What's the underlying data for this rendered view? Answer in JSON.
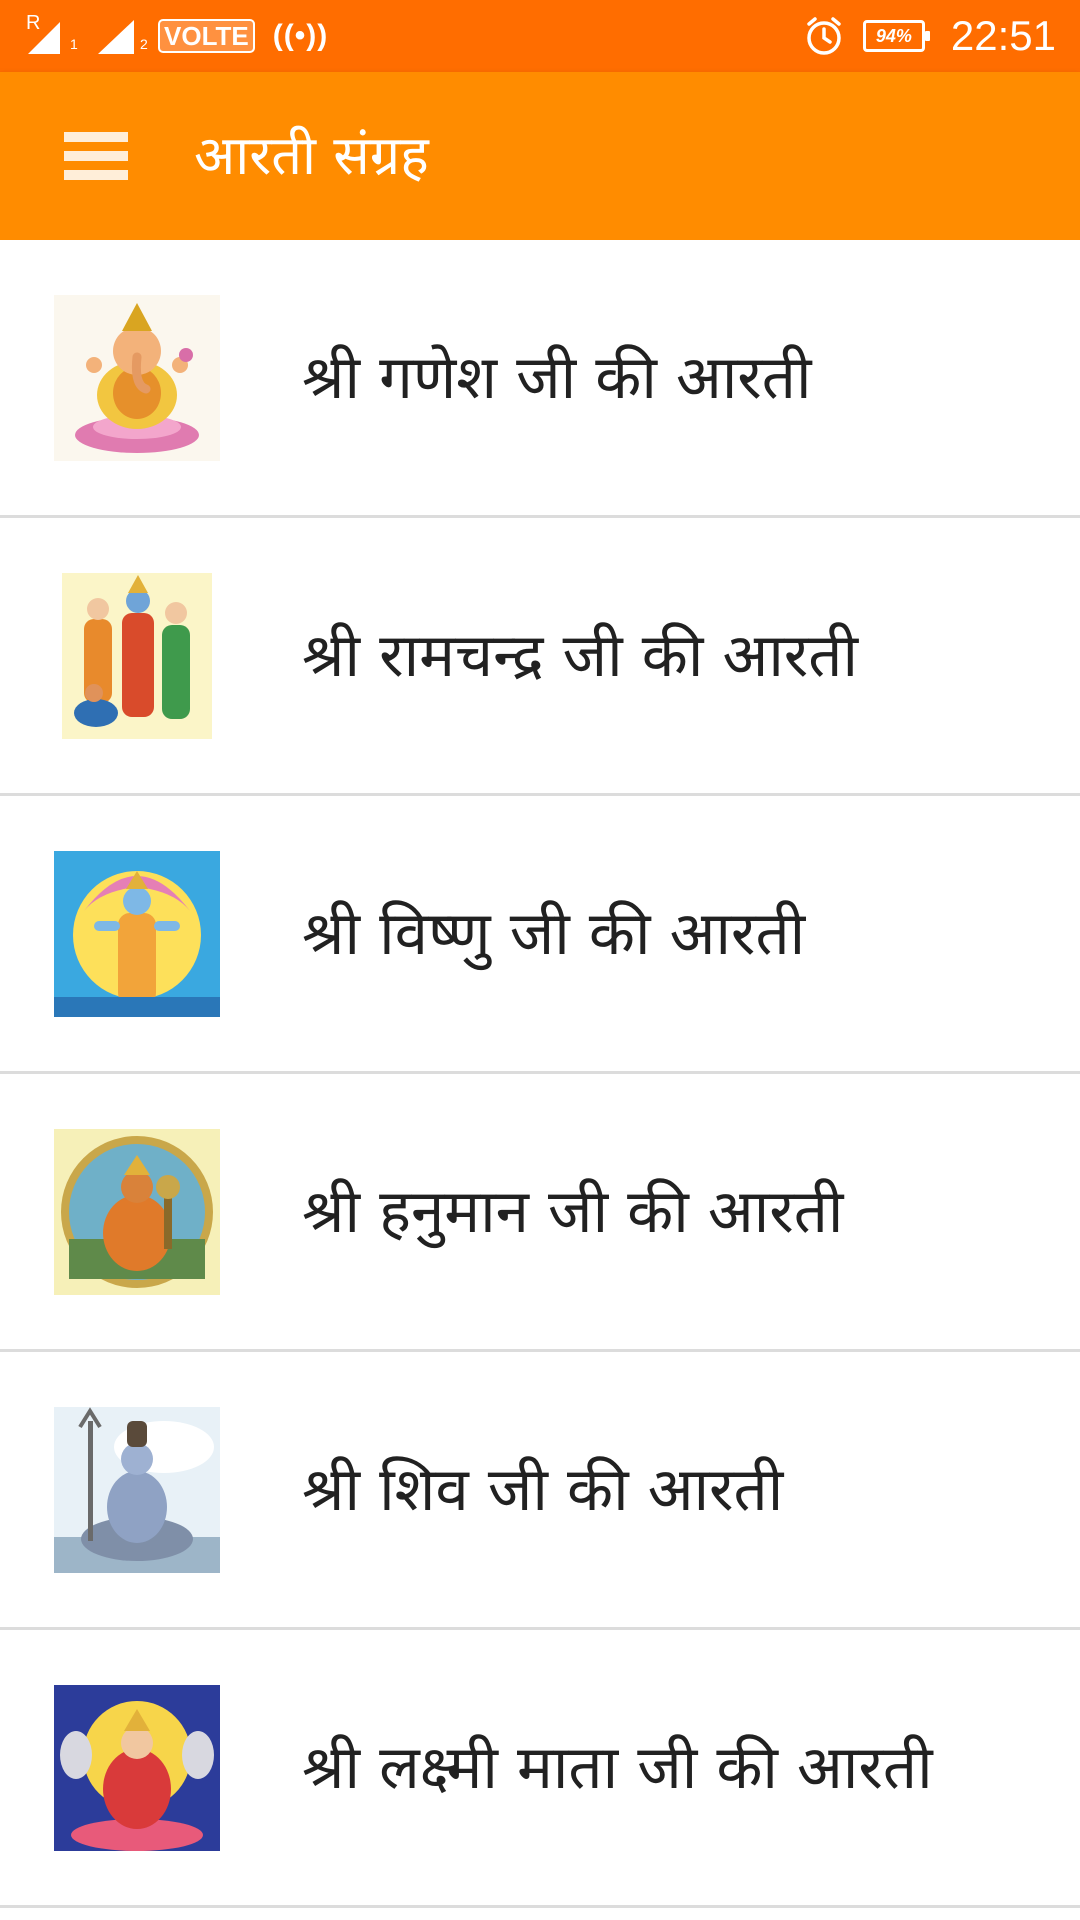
{
  "status_bar": {
    "roaming_tag": "R",
    "sim1_tag": "1",
    "sim2_tag": "2",
    "volte": "VOLTE",
    "hotspot": "((•))",
    "battery": "94%",
    "time": "22:51",
    "icons": [
      "signal-icon",
      "hotspot-icon",
      "alarm-icon",
      "battery-icon"
    ]
  },
  "app_bar": {
    "title": "आरती संग्रह",
    "menu_icon": "hamburger-menu-icon"
  },
  "colors": {
    "status_bar": "#ff6d00",
    "app_bar": "#ff8c00",
    "divider": "#dcdcdc",
    "text": "#212121"
  },
  "items": [
    {
      "label": "श्री गणेश जी की आरती",
      "icon": "ganesh-image"
    },
    {
      "label": "श्री रामचन्द्र जी की आरती",
      "icon": "ram-image"
    },
    {
      "label": "श्री विष्णु जी की आरती",
      "icon": "vishnu-image"
    },
    {
      "label": "श्री हनुमान जी की आरती",
      "icon": "hanuman-image"
    },
    {
      "label": "श्री शिव जी की आरती",
      "icon": "shiv-image"
    },
    {
      "label": "श्री लक्ष्मी माता जी की आरती",
      "icon": "lakshmi-image"
    }
  ]
}
